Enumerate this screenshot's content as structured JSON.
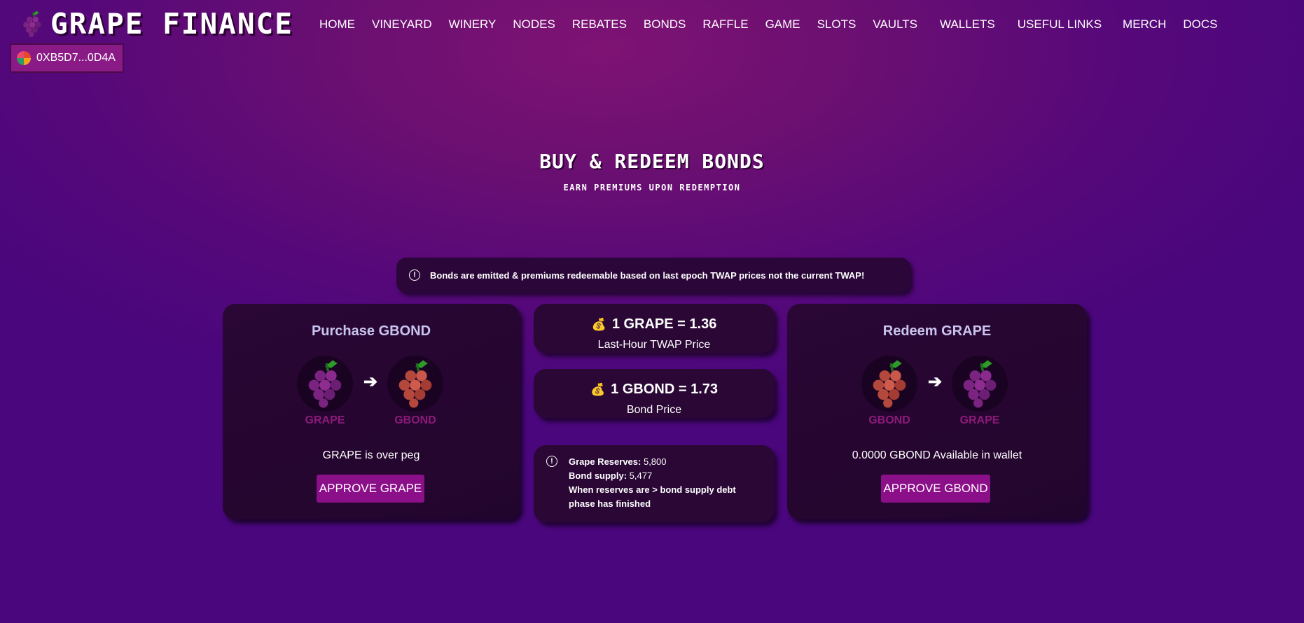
{
  "header": {
    "brand": "GRAPE FINANCE",
    "nav": [
      "HOME",
      "VINEYARD",
      "WINERY",
      "NODES",
      "REBATES",
      "BONDS",
      "RAFFLE",
      "GAME",
      "SLOTS",
      "VAULTS",
      "WALLETS",
      "USEFUL LINKS",
      "MERCH",
      "DOCS"
    ],
    "wallet_address": "0XB5D7...0D4A"
  },
  "hero": {
    "title": "BUY & REDEEM BONDS",
    "subtitle": "EARN PREMIUMS UPON REDEMPTION"
  },
  "alert": {
    "icon": "info-icon",
    "text": "Bonds are emitted & premiums redeemable based on last epoch TWAP prices not the current TWAP!"
  },
  "purchase": {
    "title": "Purchase GBOND",
    "from_token": "GRAPE",
    "to_token": "GBOND",
    "status": "GRAPE is over peg",
    "button": "APPROVE GRAPE"
  },
  "twap": {
    "icon": "money-bag-icon",
    "value": "1 GRAPE = 1.36",
    "label": "Last-Hour TWAP Price"
  },
  "bond_price": {
    "icon": "money-bag-icon",
    "value": "1 GBOND = 1.73",
    "label": "Bond Price"
  },
  "reserves": {
    "reserves_label": "Grape Reserves:",
    "reserves_value": "5,800",
    "supply_label": "Bond supply:",
    "supply_value": "5,477",
    "note_line1": "When reserves are > bond supply debt",
    "note_line2": "phase has finished"
  },
  "redeem": {
    "title": "Redeem GRAPE",
    "from_token": "GBOND",
    "to_token": "GRAPE",
    "status": "0.0000 GBOND Available in wallet",
    "button": "APPROVE GBOND"
  },
  "colors": {
    "accent": "#8c0f8a",
    "card_bg": "#2a0735",
    "grape_purple": "#7b2380",
    "gbond_red": "#b5483c",
    "leaf_green": "#2f9a2a"
  }
}
